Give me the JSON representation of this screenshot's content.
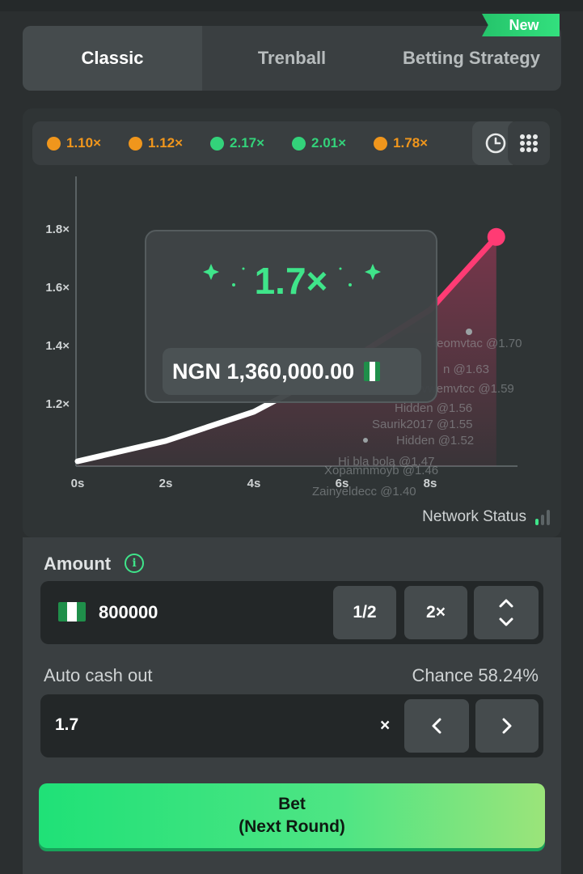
{
  "tabs": [
    {
      "label": "Classic",
      "active": true
    },
    {
      "label": "Trenball",
      "active": false
    },
    {
      "label": "Betting Strategy",
      "active": false
    }
  ],
  "new_badge": "New",
  "history": [
    {
      "value": "1.10×",
      "color": "#f0961c"
    },
    {
      "value": "1.12×",
      "color": "#f0961c"
    },
    {
      "value": "2.17×",
      "color": "#33d27a"
    },
    {
      "value": "2.01×",
      "color": "#33d27a"
    },
    {
      "value": "1.78×",
      "color": "#f0961c"
    }
  ],
  "icons": {
    "history": "clock-icon",
    "menu": "grid-icon",
    "info": "info-icon"
  },
  "chart_data": {
    "type": "line",
    "x_ticks": [
      "0s",
      "2s",
      "4s",
      "6s",
      "8s"
    ],
    "y_ticks": [
      "1.2×",
      "1.4×",
      "1.6×",
      "1.8×"
    ],
    "series": [
      {
        "x": [
          0,
          2,
          4,
          6,
          8,
          9.5
        ],
        "y": [
          1.0,
          1.07,
          1.17,
          1.33,
          1.52,
          1.77
        ]
      }
    ],
    "player_cashouts": [
      {
        "label": "feomvtac @1.70"
      },
      {
        "label": "n @1.63"
      },
      {
        "label": "Jgyvwemvtcc @1.59"
      },
      {
        "label": "Hidden @1.56"
      },
      {
        "label": "Saurik2017 @1.55"
      },
      {
        "label": "Hidden @1.52"
      },
      {
        "label": "Hi bla bola @1.47"
      },
      {
        "label": "Xopamnmoyb @1.46"
      },
      {
        "label": "Zainyeldecc @1.40"
      }
    ]
  },
  "win_card": {
    "multiplier": "1.7×",
    "amount": "NGN 1,360,000.00"
  },
  "network_status": "Network Status",
  "amount": {
    "label": "Amount",
    "value": "800000",
    "half": "1/2",
    "double": "2×"
  },
  "auto_cashout": {
    "label": "Auto cash out",
    "value": "1.7",
    "suffix": "×",
    "chance": "Chance 58.24%"
  },
  "bet_button": {
    "line1": "Bet",
    "line2": "(Next Round)"
  },
  "colors": {
    "accent": "#3fe58a",
    "line": "#ff3b74",
    "bg": "#2b2f30"
  }
}
